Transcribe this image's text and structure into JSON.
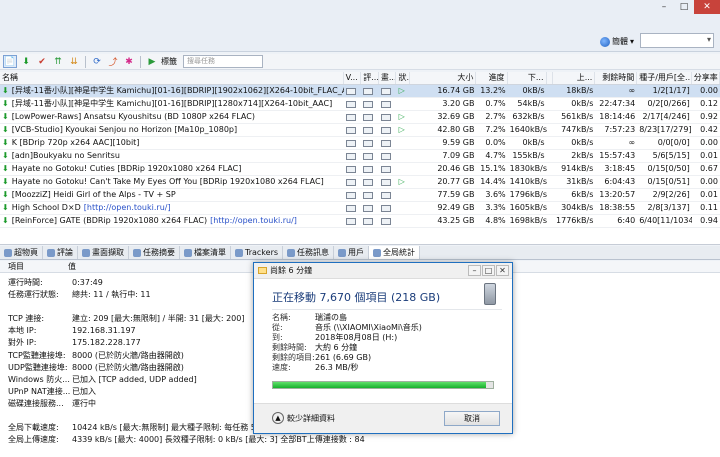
{
  "topbar": {
    "window_buttons": [
      "–",
      "□",
      "✕"
    ],
    "language": "簡體",
    "lang_dropdown": "▾"
  },
  "toolbar": {
    "tag_label": "標籤",
    "search_placeholder": "搜尋任務"
  },
  "grid": {
    "headers": [
      "名稱",
      "V...",
      "評...",
      "畫...",
      "狀...",
      "大小",
      "進度",
      "下...",
      "上...",
      "剩餘時間",
      "種子/用戶[全...",
      "分享率"
    ],
    "rows": [
      {
        "name": "[异域-11番小队][神是中学生 Kamichu][01-16][BDRIP][1902x1062][X264-10bit_FLAC_AACx2]",
        "link": "",
        "selected": true,
        "size": "16.74 GB",
        "progress": "13.2%",
        "down": "0kB/s",
        "up": "18kB/s",
        "eta": "∞",
        "peers": "1/2[1/17]",
        "ratio": "0.00",
        "play": true
      },
      {
        "name": "[异域-11番小队][神是中学生 Kamichu][01-16][BDRIP][1280x714][X264-10bit_AAC]",
        "link": "",
        "selected": false,
        "size": "3.20 GB",
        "progress": "0.7%",
        "down": "54kB/s",
        "up": "0kB/s",
        "eta": "22:47:34",
        "peers": "0/2[0/266]",
        "ratio": "0.12",
        "play": false
      },
      {
        "name": "[LowPower-Raws] Ansatsu Kyoushitsu (BD 1080P x264 FLAC)",
        "link": "",
        "selected": false,
        "size": "32.69 GB",
        "progress": "2.7%",
        "down": "632kB/s",
        "up": "561kB/s",
        "eta": "18:14:46",
        "peers": "2/17[4/246]",
        "ratio": "0.92",
        "play": true
      },
      {
        "name": "[VCB-Studio] Kyoukai Senjou no Horizon [Ma10p_1080p]",
        "link": "",
        "selected": false,
        "size": "42.80 GB",
        "progress": "7.2%",
        "down": "1640kB/s",
        "up": "747kB/s",
        "eta": "7:57:23",
        "peers": "8/23[17/279]",
        "ratio": "0.42",
        "play": true
      },
      {
        "name": "K [BDrip 720p x264 AAC][10bit]",
        "link": "",
        "selected": false,
        "size": "9.59 GB",
        "progress": "0.0%",
        "down": "0kB/s",
        "up": "0kB/s",
        "eta": "∞",
        "peers": "0/0[0/0]",
        "ratio": "0.00",
        "play": false
      },
      {
        "name": "[adn]Boukyaku no Senritsu",
        "link": "",
        "selected": false,
        "size": "7.09 GB",
        "progress": "4.7%",
        "down": "155kB/s",
        "up": "2kB/s",
        "eta": "15:57:43",
        "peers": "5/6[5/15]",
        "ratio": "0.01",
        "play": false
      },
      {
        "name": "Hayate no Gotoku! Cuties [BDRip 1920x1080 x264 FLAC]",
        "link": "",
        "selected": false,
        "size": "20.46 GB",
        "progress": "15.1%",
        "down": "1830kB/s",
        "up": "914kB/s",
        "eta": "3:18:45",
        "peers": "0/15[0/50]",
        "ratio": "0.67",
        "play": false
      },
      {
        "name": "Hayate no Gotoku! Can't Take My Eyes Off You [BDRip 1920x1080 x264 FLAC]",
        "link": "",
        "selected": false,
        "size": "20.77 GB",
        "progress": "14.4%",
        "down": "1410kB/s",
        "up": "31kB/s",
        "eta": "6:04:43",
        "peers": "0/15[0/51]",
        "ratio": "0.00",
        "play": true
      },
      {
        "name": "[MoozziZ] Heidi Girl of the Alps - TV + SP",
        "link": "",
        "selected": false,
        "size": "77.59 GB",
        "progress": "3.6%",
        "down": "1796kB/s",
        "up": "6kB/s",
        "eta": "13:20:57",
        "peers": "2/9[2/26]",
        "ratio": "0.01",
        "play": false
      },
      {
        "name": "High School D×D",
        "link": "[http://open.touki.ru/]",
        "selected": false,
        "size": "92.49 GB",
        "progress": "3.3%",
        "down": "1605kB/s",
        "up": "304kB/s",
        "eta": "18:38:55",
        "peers": "2/8[3/137]",
        "ratio": "0.11",
        "play": false
      },
      {
        "name": "[ReinForce] GATE (BDRip 1920x1080 x264 FLAC)",
        "link": "[http://open.touki.ru/]",
        "selected": false,
        "size": "43.25 GB",
        "progress": "4.8%",
        "down": "1698kB/s",
        "up": "1776kB/s",
        "eta": "6:40",
        "peers": "6/40[11/1034]",
        "ratio": "0.94",
        "play": false
      }
    ]
  },
  "tabs": [
    {
      "label": "超物頁",
      "icon": "info-icon",
      "active": false
    },
    {
      "label": "評論",
      "icon": "comment-icon",
      "active": false
    },
    {
      "label": "畫面擷取",
      "icon": "image-icon",
      "active": false
    },
    {
      "label": "任務摘要",
      "icon": "list-icon",
      "active": false
    },
    {
      "label": "檔案清單",
      "icon": "file-icon",
      "active": false
    },
    {
      "label": "Trackers",
      "icon": "tracker-icon",
      "active": false
    },
    {
      "label": "任務訊息",
      "icon": "log-icon",
      "active": false
    },
    {
      "label": "用戶",
      "icon": "user-icon",
      "active": false
    },
    {
      "label": "全局統計",
      "icon": "stats-icon",
      "active": true
    }
  ],
  "stats": {
    "headers": [
      "項目",
      "值"
    ],
    "rows": [
      {
        "k": "運行時間:",
        "v": "0:37:49"
      },
      {
        "k": "任務運行狀態:",
        "v": "總共: 11 / 執行中: 11"
      },
      {
        "k": "TCP 連接:",
        "v": "建立: 209 [最大:無限制] / 半開: 31 [最大: 200]"
      },
      {
        "k": "本地 IP:",
        "v": "192.168.31.197"
      },
      {
        "k": "對外 IP:",
        "v": "175.182.228.177"
      },
      {
        "k": "TCP監聽連接埠:",
        "v": "8000 (已於防火牆/路由器開啟)"
      },
      {
        "k": "UDP監聽連接埠:",
        "v": "8000 (已於防火牆/路由器開啟)"
      },
      {
        "k": "Windows 防火...",
        "v": "已加入 [TCP added, UDP added]"
      },
      {
        "k": "UPnP NAT連接...",
        "v": "已加入"
      },
      {
        "k": "磁碟連接服務...",
        "v": "運行中"
      },
      {
        "k": "全局下載速度:",
        "v": "10424 kB/s [最大:無限制]    最大種子限制: 每任務 50"
      },
      {
        "k": "全局上傳速度:",
        "v": "4339 kB/s [最大: 4000]    長效種子限制: 0 kB/s [最大: 3]    全部BT上傳連接數 : 84"
      }
    ]
  },
  "dialog": {
    "title": "尚餘 6 分鐘",
    "heading": "正在移動 7,670 個項目 (218 GB)",
    "fields": [
      {
        "k": "名稱:",
        "v": "瑞浦の島"
      },
      {
        "k": "從:",
        "v": "音乐 (\\\\XIAOMI\\XiaoMi\\音乐)"
      },
      {
        "k": "到:",
        "v": "2018年08月08日 (H:)"
      },
      {
        "k": "剩餘時間:",
        "v": "大約 6 分鐘"
      },
      {
        "k": "剩餘的項目:",
        "v": "261 (6.69 GB)"
      },
      {
        "k": "速度:",
        "v": "26.3 MB/秒"
      }
    ],
    "progress": 0.97,
    "less_details": "較少詳細資料",
    "cancel": "取消",
    "buttons": [
      "–",
      "□",
      "✕"
    ]
  }
}
